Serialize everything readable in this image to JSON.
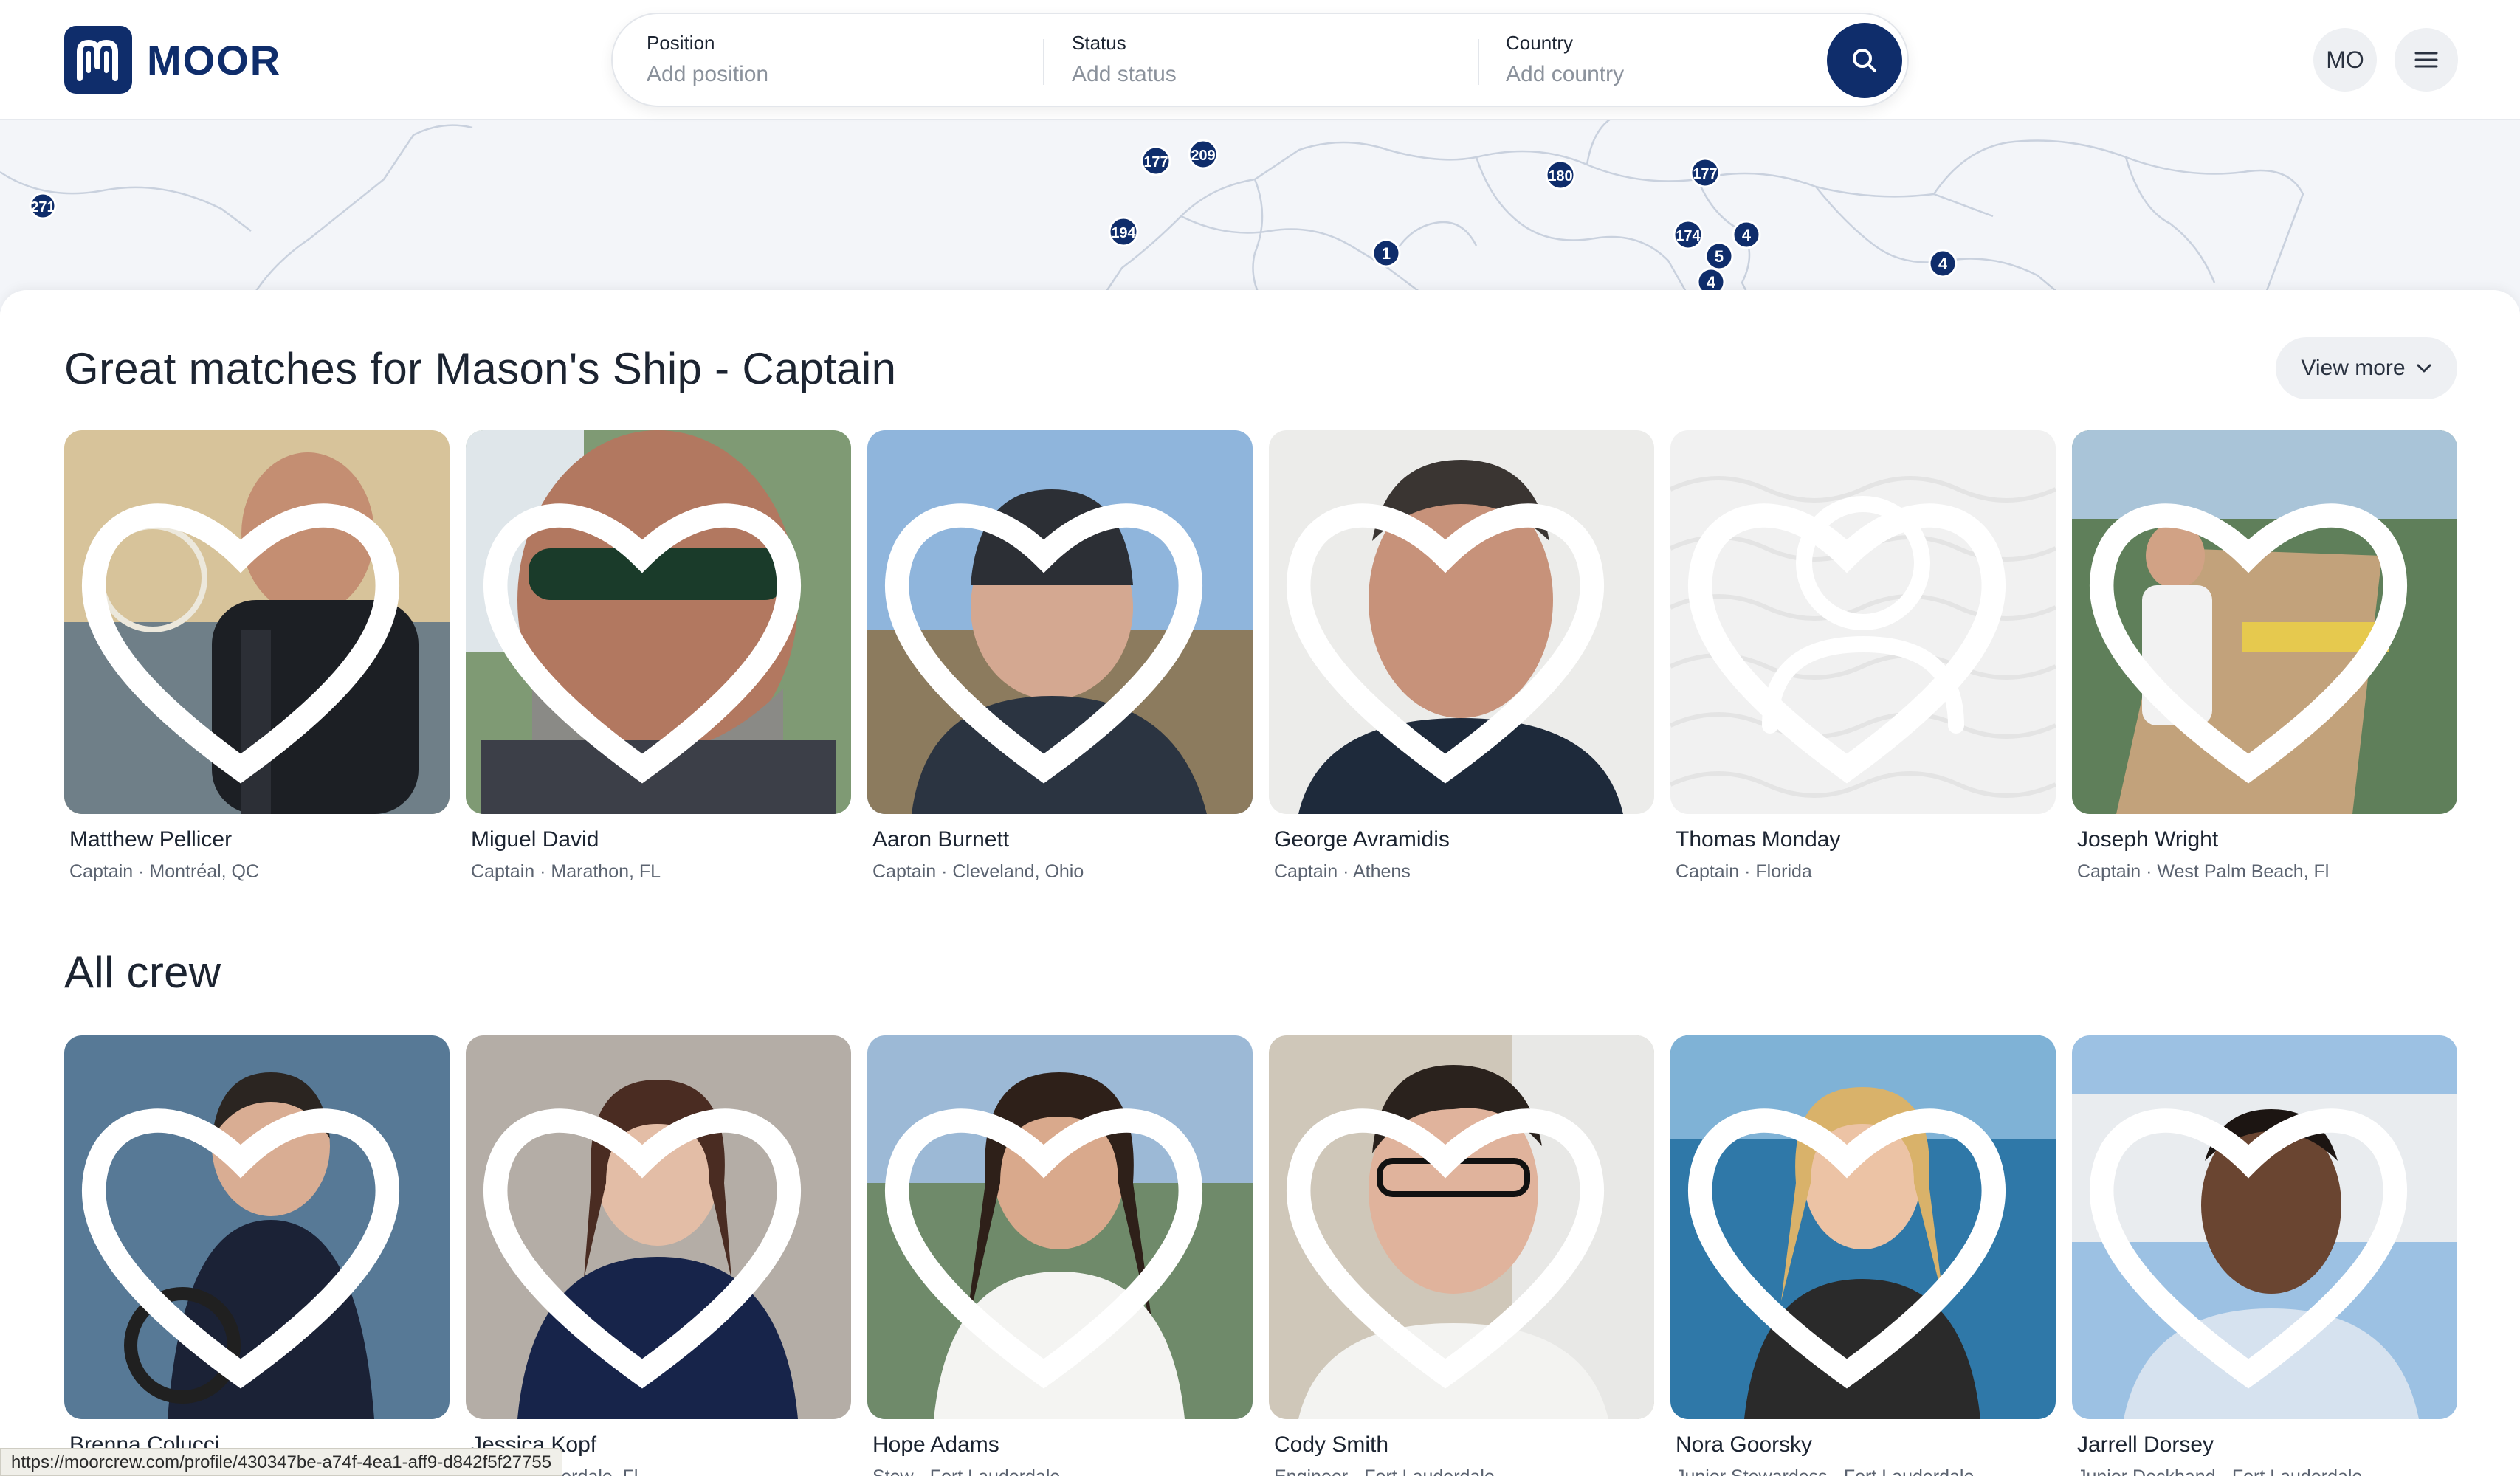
{
  "brand": {
    "name": "MOOR"
  },
  "search": {
    "position": {
      "label": "Position",
      "placeholder": "Add position"
    },
    "status": {
      "label": "Status",
      "placeholder": "Add status"
    },
    "country": {
      "label": "Country",
      "placeholder": "Add country"
    }
  },
  "user": {
    "initials": "MO"
  },
  "map": {
    "markers": [
      {
        "label": "271"
      },
      {
        "label": "177"
      },
      {
        "label": "209"
      },
      {
        "label": "194"
      },
      {
        "label": "1"
      },
      {
        "label": "180"
      },
      {
        "label": "177"
      },
      {
        "label": "174"
      },
      {
        "label": "4"
      },
      {
        "label": "5"
      },
      {
        "label": "4"
      },
      {
        "label": "4"
      }
    ]
  },
  "matches": {
    "title": "Great matches for Mason's Ship - Captain",
    "view_more": "View more",
    "cards": [
      {
        "name": "Matthew Pellicer",
        "meta": "Captain · Montréal, QC"
      },
      {
        "name": "Miguel David",
        "meta": "Captain · Marathon, FL"
      },
      {
        "name": "Aaron Burnett",
        "meta": "Captain · Cleveland, Ohio"
      },
      {
        "name": "George Avramidis",
        "meta": "Captain · Athens"
      },
      {
        "name": "Thomas Monday",
        "meta": "Captain · Florida"
      },
      {
        "name": "Joseph Wright",
        "meta": "Captain · West Palm Beach, Fl"
      }
    ]
  },
  "crew": {
    "title": "All crew",
    "cards": [
      {
        "name": "Brenna Colucci",
        "meta": ""
      },
      {
        "name": "Jessica Kopf",
        "meta": "· Fort Lauderdale, Fl"
      },
      {
        "name": "Hope Adams",
        "meta": "Stew · Fort Lauderdale"
      },
      {
        "name": "Cody Smith",
        "meta": "Engineer · Fort Lauderdale"
      },
      {
        "name": "Nora Goorsky",
        "meta": "Junior Stewardess · Fort Lauderdale"
      },
      {
        "name": "Jarrell Dorsey",
        "meta": "Junior Deckhand · Fort Lauderdale"
      }
    ]
  },
  "status_bar": {
    "url": "https://moorcrew.com/profile/430347be-a74f-4ea1-aff9-d842f5f27755"
  },
  "colors": {
    "brand_navy": "#0f2d6b",
    "text": "#1c2431",
    "muted": "#5b6370",
    "chip_bg": "#eef0f3"
  }
}
